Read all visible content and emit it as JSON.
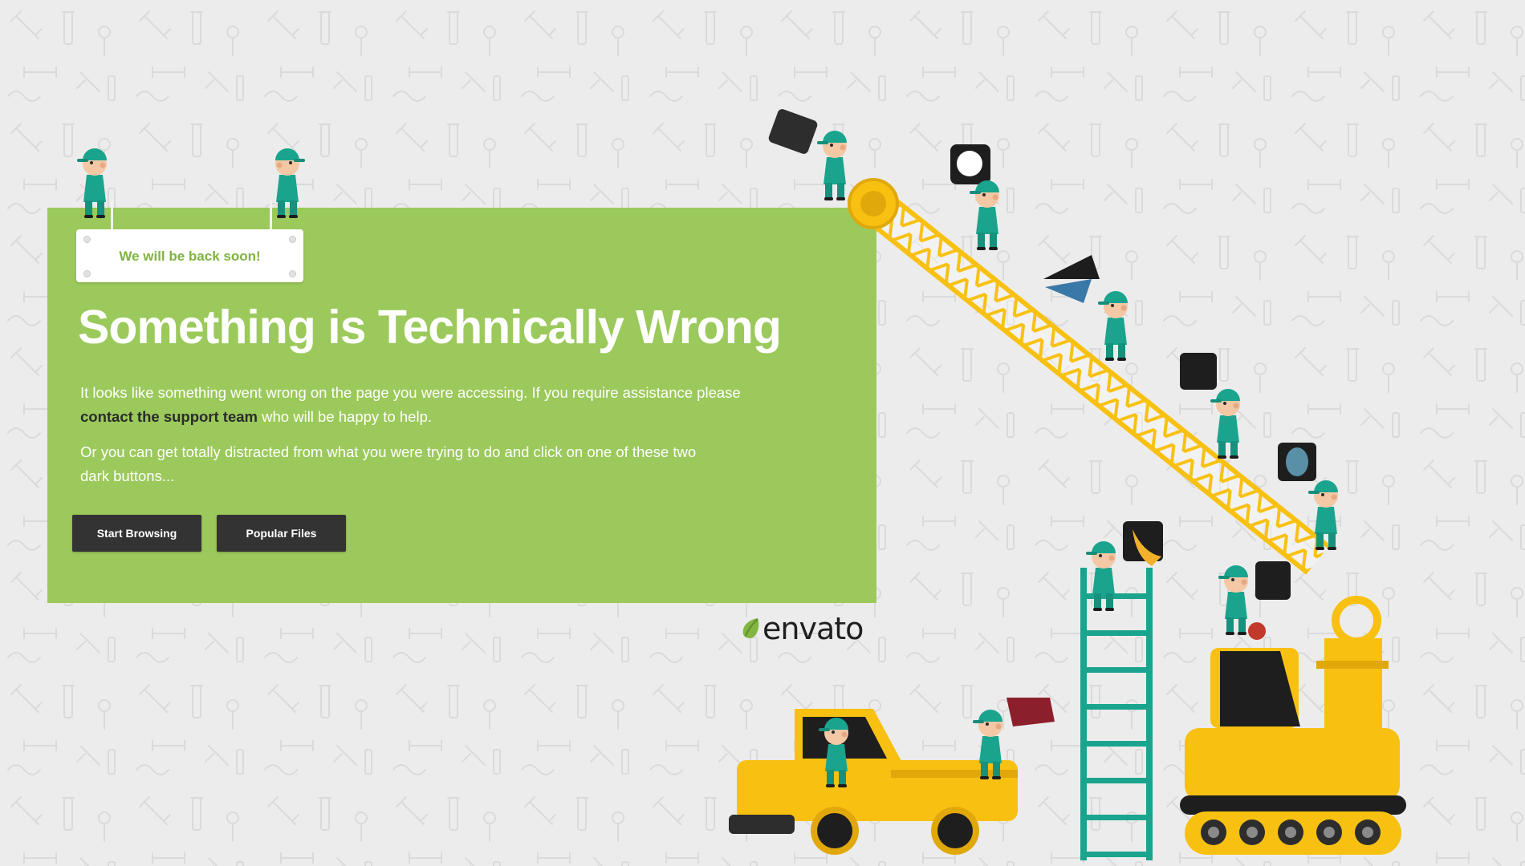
{
  "sign": {
    "text": "We will be back soon!"
  },
  "main": {
    "title": "Something is Technically Wrong",
    "paragraph1_start": "It looks like something went wrong on the page you were accessing. If you require assistance please",
    "support_link": "contact the support team",
    "paragraph1_end": "who will be happy to help.",
    "paragraph2": "Or you can get totally distracted from what you were trying to do and click on one of these two dark buttons..."
  },
  "buttons": {
    "start_browsing": "Start Browsing",
    "popular_files": "Popular Files"
  },
  "brand": {
    "logo_text": "envato"
  },
  "colors": {
    "panel": "#9bc95b",
    "button": "#333333",
    "sign_text": "#7fb342",
    "machine_yellow": "#f8c112",
    "worker_teal": "#1aa48e",
    "background": "#ececec"
  }
}
